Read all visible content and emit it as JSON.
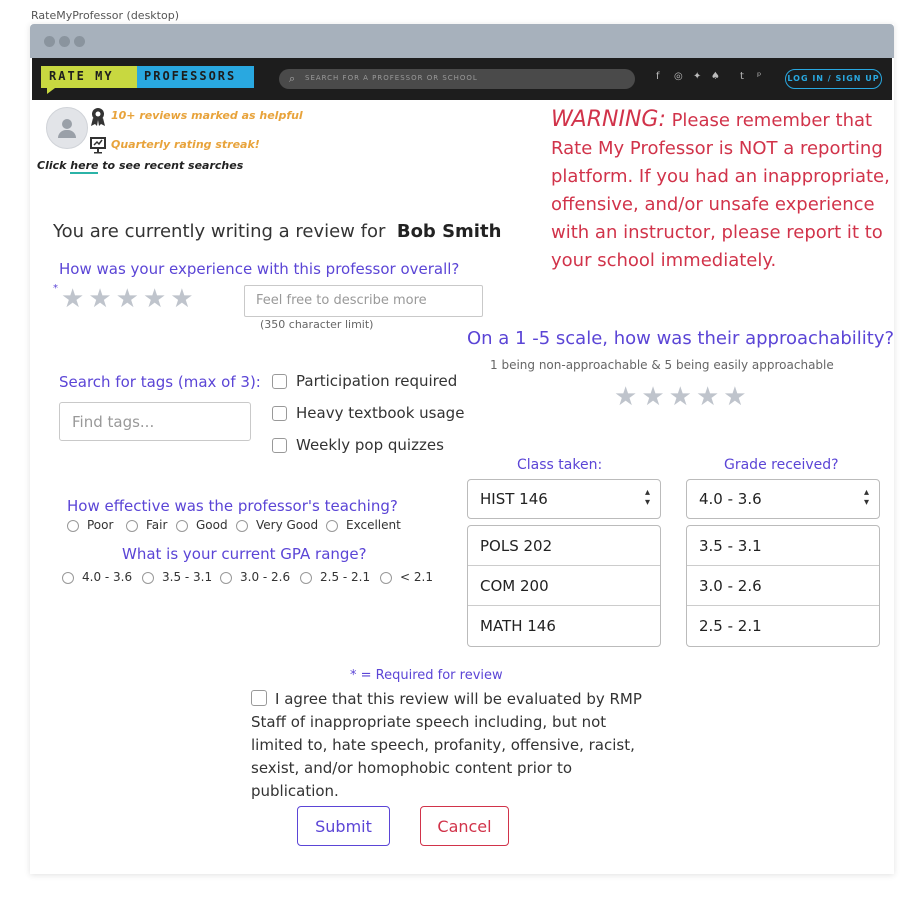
{
  "window": {
    "caption": "RateMyProfessor (desktop)"
  },
  "nav": {
    "logo_left": "RATE MY",
    "logo_right": "PROFESSORS",
    "search_placeholder": "SEARCH FOR A PROFESSOR OR SCHOOL",
    "social_icons": [
      "facebook-icon",
      "instagram-icon",
      "twitter-icon",
      "snapchat-icon",
      "tumblr-icon",
      "pinterest-icon"
    ],
    "social_glyphs": [
      "f",
      "◎",
      "✦",
      "♠",
      "t",
      "ᵖ"
    ],
    "login_label": "LOG IN / SIGN UP"
  },
  "profile": {
    "badge1": "10+ reviews marked as helpful",
    "badge2": "Quarterly rating streak!",
    "recent_prefix": "Click ",
    "recent_link": "here",
    "recent_suffix": " to see recent searches"
  },
  "warning": {
    "lead": "WARNING:",
    "body": " Please remember that Rate My Professor is NOT a reporting platform. If you had an inappropriate, offensive, and/or unsafe experience with an instructor, please report it to your school immediately."
  },
  "review": {
    "heading_prefix": "You are currently writing a review for",
    "professor": "Bob Smith",
    "overall_question": "How was your experience with this professor overall?",
    "required_marker": "*",
    "star_glyph": "★",
    "description_placeholder": "Feel free to describe more",
    "char_limit": "(350 character limit)"
  },
  "approachability": {
    "question": "On a 1 -5 scale, how was their approachability?",
    "hint": "1 being non-approachable & 5 being easily approachable"
  },
  "tags": {
    "label": "Search for tags (max of 3):",
    "placeholder": "Find tags...",
    "options": [
      "Participation required",
      "Heavy textbook usage",
      "Weekly pop quizzes"
    ]
  },
  "teaching": {
    "question": "How effective was the professor's teaching?",
    "options": [
      "Poor",
      "Fair",
      "Good",
      "Very Good",
      "Excellent"
    ]
  },
  "gpa": {
    "question": "What is your current GPA range?",
    "options": [
      "4.0 - 3.6",
      "3.5 - 3.1",
      "3.0 - 2.6",
      "2.5 - 2.1",
      "< 2.1"
    ]
  },
  "class_select": {
    "label": "Class taken:",
    "selected": "HIST 146",
    "options": [
      "POLS 202",
      "COM 200",
      "MATH 146"
    ]
  },
  "grade_select": {
    "label": "Grade received?",
    "selected": "4.0 - 3.6",
    "options": [
      "3.5 - 3.1",
      "3.0 - 2.6",
      "2.5 - 2.1"
    ]
  },
  "footer": {
    "required_note": "*  = Required for review",
    "agreement": "I agree that this review will be evaluated by RMP Staff of inappropriate speech including, but not limited to, hate speech, profanity, offensive, racist, sexist, and/or homophobic content prior to publication.",
    "submit_label": "Submit",
    "cancel_label": "Cancel"
  }
}
